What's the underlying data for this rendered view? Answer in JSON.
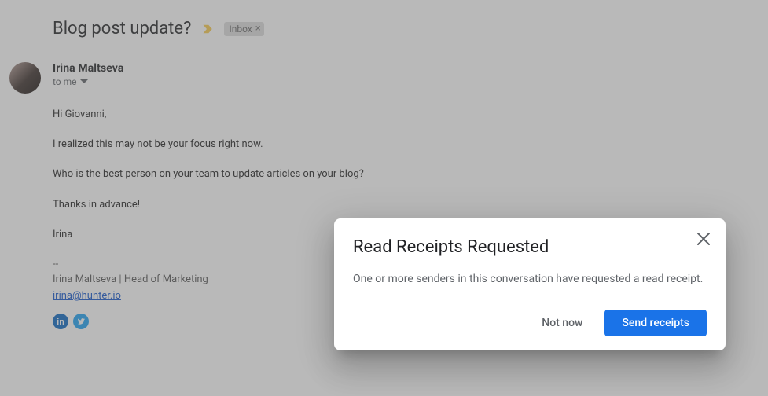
{
  "email": {
    "subject": "Blog post update?",
    "label_chip": "Inbox",
    "sender_name": "Irina Maltseva",
    "to_line": "to me",
    "body": {
      "greeting": "Hi Giovanni,",
      "line1": "I realized this may not be your focus right now.",
      "line2": "Who is the best person on your team to update articles on your blog?",
      "thanks": "Thanks in advance!",
      "signoff_name": "Irina"
    },
    "signature": {
      "separator": "--",
      "line": "Irina Maltseva | Head of Marketing",
      "email": "irina@hunter.io"
    }
  },
  "dialog": {
    "title": "Read Receipts Requested",
    "body": "One or more senders in this conversation have requested a read receipt.",
    "not_now_label": "Not now",
    "send_label": "Send receipts"
  }
}
